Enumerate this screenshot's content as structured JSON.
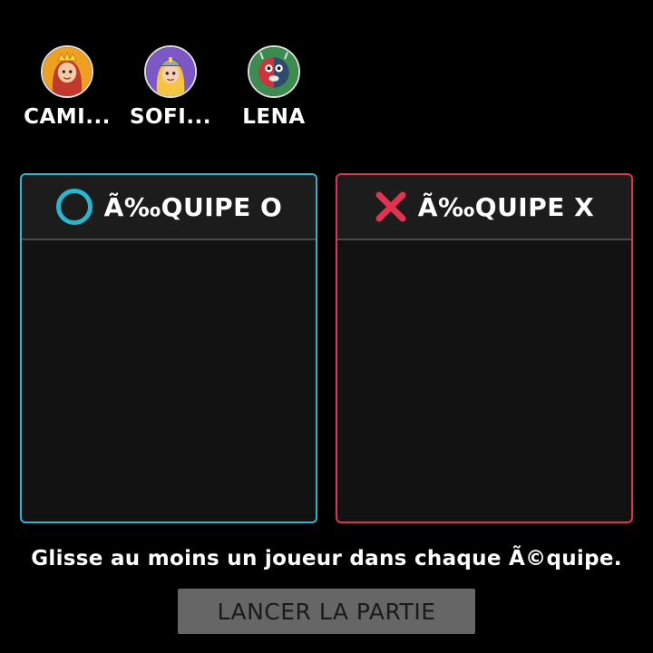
{
  "players": [
    {
      "name": "CAMI...",
      "avatar_icon": "queen-avatar-icon",
      "ring_color": "#f0a020"
    },
    {
      "name": "SOFI...",
      "avatar_icon": "valkyrie-avatar-icon",
      "ring_color": "#7b57c8"
    },
    {
      "name": "LENA",
      "avatar_icon": "monster-avatar-icon",
      "ring_color": "#3c8c50"
    }
  ],
  "teams": {
    "o": {
      "title": "Ã‰QUIPE O",
      "icon": "circle-icon",
      "color": "#29b6d0"
    },
    "x": {
      "title": "Ã‰QUIPE X",
      "icon": "cross-icon",
      "color": "#e4314f"
    }
  },
  "hint": "Glisse au moins un joueur dans chaque Ã©quipe.",
  "start_button": {
    "label": "LANCER LA PARTIE",
    "enabled": false
  }
}
